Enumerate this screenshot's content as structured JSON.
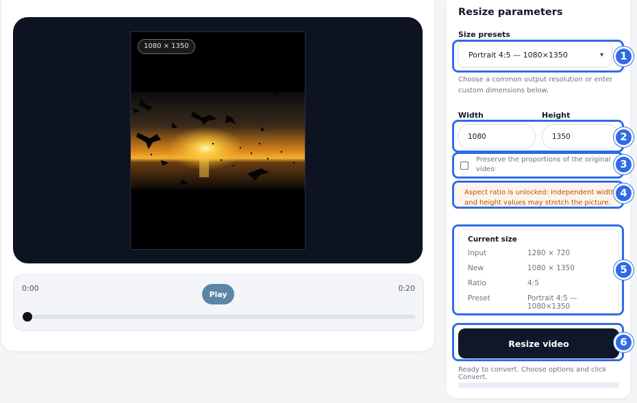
{
  "preview": {
    "dimension_badge": "1080 × 1350"
  },
  "player": {
    "time_start": "0:00",
    "time_end": "0:20",
    "play_label": "Play",
    "progress": 0
  },
  "resize": {
    "title": "Resize parameters",
    "presets_label": "Size presets",
    "preset_value": "Portrait 4:5 — 1080×1350",
    "presets_help": "Choose a common output resolution or enter custom dimensions below.",
    "width_label": "Width",
    "width_value": "1080",
    "height_label": "Height",
    "height_value": "1350",
    "preserve_label": "Preserve the proportions of the original video",
    "preserve_checked": false,
    "warning": "Aspect ratio is unlocked: independent width and height values may stretch the picture.",
    "current_size": {
      "title": "Current size",
      "rows": [
        {
          "key": "Input",
          "value": "1280 × 720"
        },
        {
          "key": "New",
          "value": "1080 × 1350"
        },
        {
          "key": "Ratio",
          "value": "4:5"
        },
        {
          "key": "Preset",
          "value": "Portrait 4:5 — 1080×1350"
        }
      ]
    },
    "resize_button": "Resize video",
    "status": "Ready to convert. Choose options and click Convert."
  },
  "annotations": [
    "1",
    "2",
    "3",
    "4",
    "5",
    "6"
  ],
  "colors": {
    "annotation": "#2f6be6",
    "stage": "#0d1321",
    "primary_button": "#0f172a",
    "play_button": "#5a86a8",
    "warning_bg": "#fff4ea",
    "warning_text": "#b45309"
  }
}
